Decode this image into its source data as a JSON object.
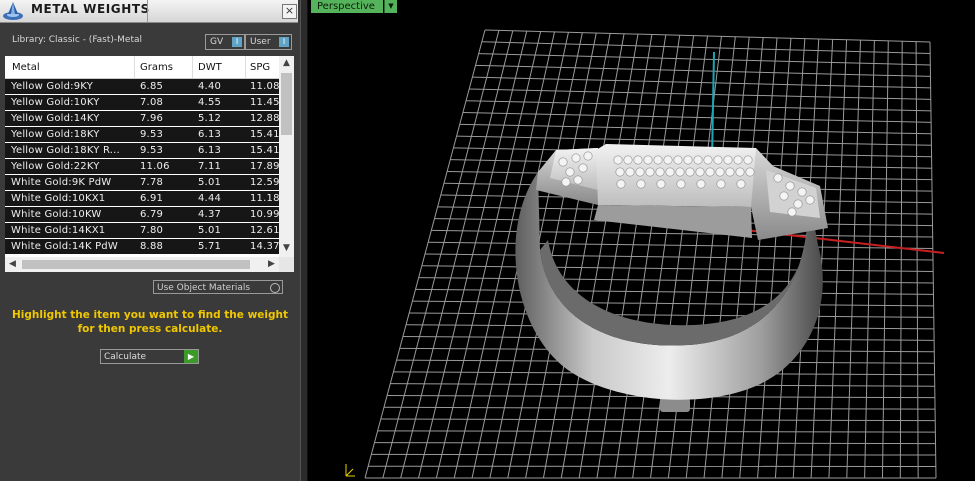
{
  "panel": {
    "title": "METAL WEIGHTS",
    "close": "×",
    "library_label": "Library: Classic - (Fast)-Metal",
    "toggles": [
      {
        "label": "GV"
      },
      {
        "label": "User"
      }
    ],
    "table": {
      "columns": [
        "Metal",
        "Grams",
        "DWT",
        "SPG"
      ],
      "rows": [
        {
          "metal": "Yellow Gold:9KY",
          "grams": "6.85",
          "dwt": "4.40",
          "spg": "11.08"
        },
        {
          "metal": "Yellow Gold:10KY",
          "grams": "7.08",
          "dwt": "4.55",
          "spg": "11.45"
        },
        {
          "metal": "Yellow Gold:14KY",
          "grams": "7.96",
          "dwt": "5.12",
          "spg": "12.88"
        },
        {
          "metal": "Yellow Gold:18KY",
          "grams": "9.53",
          "dwt": "6.13",
          "spg": "15.41"
        },
        {
          "metal": "Yellow Gold:18KY R...",
          "grams": "9.53",
          "dwt": "6.13",
          "spg": "15.41"
        },
        {
          "metal": "Yellow Gold:22KY",
          "grams": "11.06",
          "dwt": "7.11",
          "spg": "17.89"
        },
        {
          "metal": "White Gold:9K PdW",
          "grams": "7.78",
          "dwt": "5.01",
          "spg": "12.59"
        },
        {
          "metal": "White Gold:10KX1",
          "grams": "6.91",
          "dwt": "4.44",
          "spg": "11.18"
        },
        {
          "metal": "White Gold:10KW",
          "grams": "6.79",
          "dwt": "4.37",
          "spg": "10.99"
        },
        {
          "metal": "White Gold:14KX1",
          "grams": "7.80",
          "dwt": "5.01",
          "spg": "12.61"
        },
        {
          "metal": "White Gold:14K PdW",
          "grams": "8.88",
          "dwt": "5.71",
          "spg": "14.37"
        }
      ]
    },
    "use_object_materials": "Use Object Materials",
    "hint": "Highlight the item you want to find the weight for then press calculate.",
    "calculate": "Calculate"
  },
  "viewport": {
    "label": "Perspective",
    "grid_color": "#9a9a9a",
    "axis_x_color": "#c62020",
    "axis_y_color": "#1aa6b5",
    "accent": "#55b35b"
  }
}
